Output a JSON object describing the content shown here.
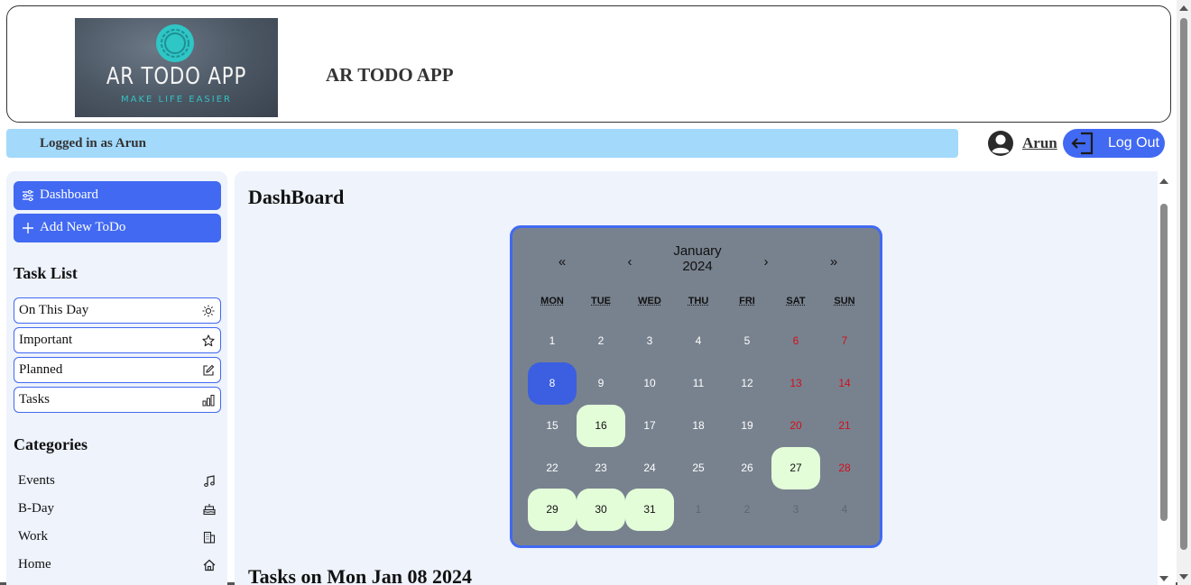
{
  "header": {
    "logo_title": "AR TODO APP",
    "logo_subtitle": "MAKE LIFE EASIER",
    "app_title": "AR TODO APP"
  },
  "status": {
    "logged_in_text": "Logged in as Arun"
  },
  "user": {
    "name": "Arun",
    "logout_label": "Log Out"
  },
  "sidebar": {
    "nav": [
      {
        "label": "Dashboard",
        "icon": "sliders-icon"
      },
      {
        "label": "Add New ToDo",
        "icon": "plus-icon"
      }
    ],
    "task_list_title": "Task List",
    "task_list": [
      {
        "label": "On This Day",
        "icon": "sun-icon"
      },
      {
        "label": "Important",
        "icon": "star-icon"
      },
      {
        "label": "Planned",
        "icon": "edit-icon"
      },
      {
        "label": "Tasks",
        "icon": "bar-chart-icon"
      }
    ],
    "categories_title": "Categories",
    "categories": [
      {
        "label": "Events",
        "icon": "music-icon"
      },
      {
        "label": "B-Day",
        "icon": "cake-icon"
      },
      {
        "label": "Work",
        "icon": "building-icon"
      },
      {
        "label": "Home",
        "icon": "home-icon"
      }
    ]
  },
  "main": {
    "title": "DashBoard",
    "tasks_heading": "Tasks on Mon Jan 08 2024"
  },
  "calendar": {
    "prev_year": "«",
    "prev_month": "‹",
    "month_label_line1": "January",
    "month_label_line2": "2024",
    "next_month": "›",
    "next_year": "»",
    "weekdays": [
      "MON",
      "TUE",
      "WED",
      "THU",
      "FRI",
      "SAT",
      "SUN"
    ],
    "weeks": [
      [
        "1",
        "2",
        "3",
        "4",
        "5",
        "6",
        "7"
      ],
      [
        "8",
        "9",
        "10",
        "11",
        "12",
        "13",
        "14"
      ],
      [
        "15",
        "16",
        "17",
        "18",
        "19",
        "20",
        "21"
      ],
      [
        "22",
        "23",
        "24",
        "25",
        "26",
        "27",
        "28"
      ],
      [
        "29",
        "30",
        "31",
        "1",
        "2",
        "3",
        "4"
      ]
    ],
    "selected_day": "8",
    "days_with_tasks": [
      "16",
      "27",
      "29",
      "30",
      "31"
    ],
    "colors": {
      "background": "#78828f",
      "border": "#4169f2",
      "selected": "#3b5fe0",
      "has_task": "#e4fdd9",
      "weekend": "#d20f1a"
    }
  },
  "colors": {
    "accent": "#4169f2",
    "status_bar": "#a3d9fb",
    "panel_bg": "#eef3fc"
  }
}
